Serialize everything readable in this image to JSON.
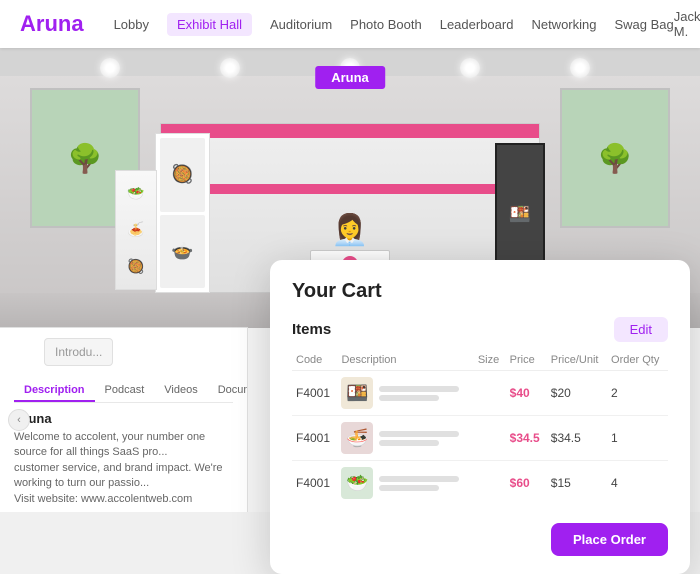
{
  "app": {
    "logo": "Aruna",
    "user": "Jack M."
  },
  "nav": {
    "items": [
      {
        "label": "Lobby",
        "active": false
      },
      {
        "label": "Exhibit Hall",
        "active": true
      },
      {
        "label": "Auditorium",
        "active": false
      },
      {
        "label": "Photo Booth",
        "active": false
      },
      {
        "label": "Leaderboard",
        "active": false
      },
      {
        "label": "Networking",
        "active": false
      },
      {
        "label": "Swag Bag",
        "active": false
      }
    ]
  },
  "booth": {
    "name": "Aruna"
  },
  "info": {
    "intro_placeholder": "Introdu...",
    "tabs": [
      "Description",
      "Podcast",
      "Videos",
      "Documents"
    ],
    "active_tab": "Description",
    "company_name": "Aruna",
    "description": "Welcome to accolent, your number one source for all things SaaS pro... customer service, and brand impact. We're working to turn our passio... Visit website: www.accolentweb.com"
  },
  "cart": {
    "title": "Your Cart",
    "items_label": "Items",
    "edit_label": "Edit",
    "columns": {
      "code": "Code",
      "description": "Description",
      "size": "Size",
      "price": "Price",
      "price_unit": "Price/Unit",
      "order_qty": "Order Qty"
    },
    "rows": [
      {
        "code": "F4001",
        "size": "",
        "price": "$40",
        "price_unit": "$20",
        "order_qty": "2",
        "img_emoji": "🍱"
      },
      {
        "code": "F4001",
        "size": "",
        "price": "$34.5",
        "price_unit": "$34.5",
        "order_qty": "1",
        "img_emoji": "🍜"
      },
      {
        "code": "F4001",
        "size": "",
        "price": "$60",
        "price_unit": "$15",
        "order_qty": "4",
        "img_emoji": "🥗"
      }
    ],
    "place_order_label": "Place Order"
  },
  "colors": {
    "brand_purple": "#a020f0",
    "brand_pink": "#e84d8a",
    "price_color": "#e84d8a"
  }
}
